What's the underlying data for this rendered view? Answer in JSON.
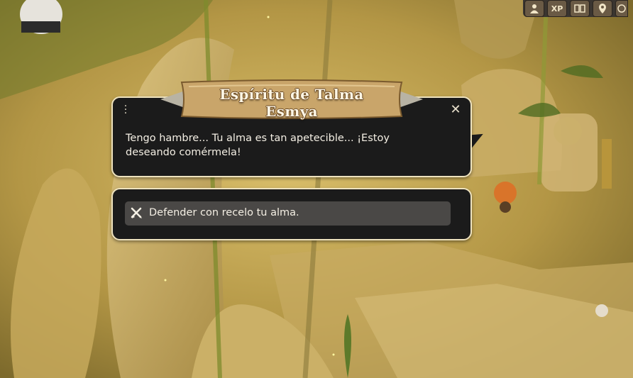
{
  "toolbar": {
    "buttons": [
      {
        "icon": "group-icon",
        "label": ""
      },
      {
        "icon": "xp-icon",
        "label": "XP"
      },
      {
        "icon": "book-icon",
        "label": ""
      },
      {
        "icon": "map-pin-icon",
        "label": ""
      },
      {
        "icon": "emote-icon",
        "label": ""
      }
    ]
  },
  "dialog": {
    "npc_name": "Espíritu de Talma Esmya",
    "text": "Tengo hambre... Tu alma es tan apetecible... ¡Estoy deseando comérmela!"
  },
  "responses": [
    {
      "icon": "crossed-swords-icon",
      "label": "Defender con recelo tu alma."
    }
  ],
  "colors": {
    "panel_bg": "#1b1b1b",
    "panel_border": "#efe3be",
    "option_bg": "#4a4846",
    "banner_parchment": "#c9a56a"
  }
}
